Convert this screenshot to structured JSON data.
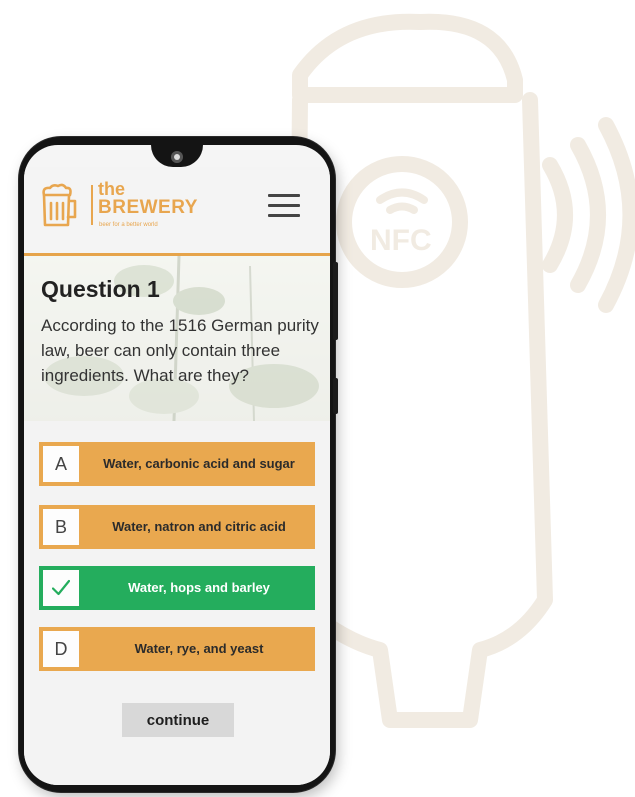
{
  "brand": {
    "the": "the",
    "name": "BREWERY",
    "tagline": "beer for a better world",
    "accent_color": "#e8a64f",
    "logo_icon": "beer-mug-icon"
  },
  "header": {
    "menu_icon": "hamburger-menu-icon"
  },
  "question": {
    "title": "Question 1",
    "text": "According to the 1516 German purity law, beer can only contain three ingredients. What are they?"
  },
  "answers": [
    {
      "letter": "A",
      "text": "Water, carbonic acid and sugar",
      "state": "default"
    },
    {
      "letter": "B",
      "text": "Water, natron and citric acid",
      "state": "default"
    },
    {
      "letter": "",
      "text": "Water, hops and barley",
      "state": "correct",
      "icon": "checkmark-icon"
    },
    {
      "letter": "D",
      "text": "Water, rye, and yeast",
      "state": "default"
    }
  ],
  "colors": {
    "answer_default": "#e9a84f",
    "answer_correct": "#24ad5d"
  },
  "continue_label": "continue",
  "background": {
    "illustration_label": "NFC"
  }
}
